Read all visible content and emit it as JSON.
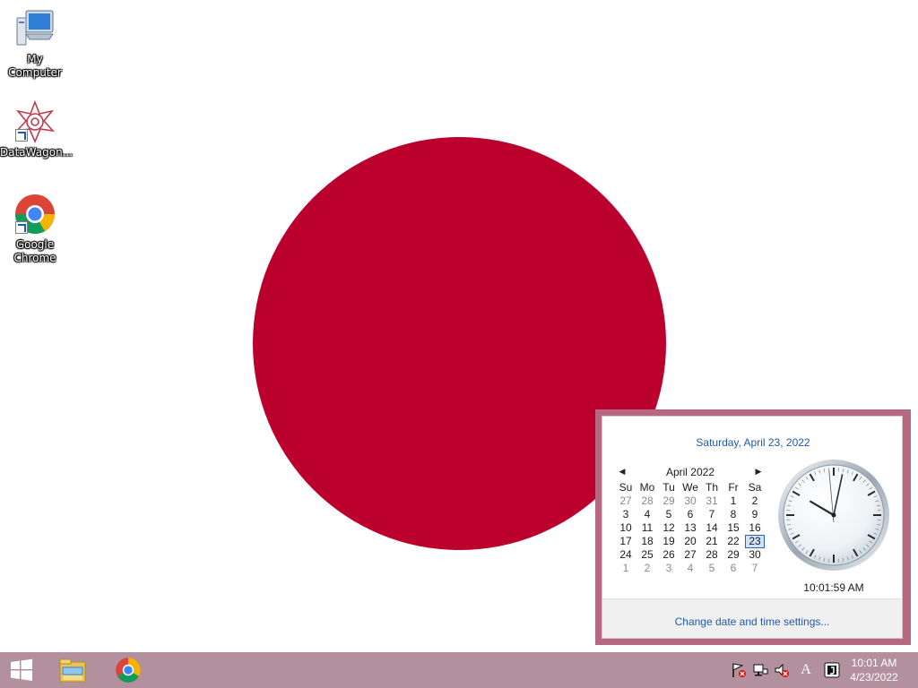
{
  "desktop": {
    "icons": [
      {
        "label": "My Computer"
      },
      {
        "label": "DataWagon..."
      },
      {
        "label": "Google\nChrome"
      }
    ]
  },
  "colors": {
    "wallpaper_background": "#ffffff",
    "wallpaper_sun": "#bc002d",
    "taskbar": "#b3909d",
    "flyout_frame": "#b5687f",
    "link": "#1f5aa6"
  },
  "flyout": {
    "date_header": "Saturday, April 23, 2022",
    "calendar": {
      "month_label": "April 2022",
      "prev_icon": "◀",
      "next_icon": "▶",
      "weekdays": [
        "Su",
        "Mo",
        "Tu",
        "We",
        "Th",
        "Fr",
        "Sa"
      ],
      "weeks": [
        [
          "27",
          "28",
          "29",
          "30",
          "31",
          "1",
          "2"
        ],
        [
          "3",
          "4",
          "5",
          "6",
          "7",
          "8",
          "9"
        ],
        [
          "10",
          "11",
          "12",
          "13",
          "14",
          "15",
          "16"
        ],
        [
          "17",
          "18",
          "19",
          "20",
          "21",
          "22",
          "23"
        ],
        [
          "24",
          "25",
          "26",
          "27",
          "28",
          "29",
          "30"
        ],
        [
          "1",
          "2",
          "3",
          "4",
          "5",
          "6",
          "7"
        ]
      ],
      "other_month_days": {
        "first_row": [
          0,
          1,
          2,
          3,
          4
        ],
        "last_row": [
          0,
          1,
          2,
          3,
          4,
          5,
          6
        ]
      },
      "selected_day": "23"
    },
    "analog_time": {
      "hour": 10,
      "minute": 1,
      "second": 59
    },
    "digital_time": "10:01:59 AM",
    "change_link": "Change date and time settings..."
  },
  "taskbar": {
    "start_icon": "windows-start-icon",
    "pinned": [
      "file-explorer-icon",
      "chrome-icon"
    ],
    "tray_icons": [
      "action-center-flag-icon",
      "network-icon",
      "volume-muted-icon",
      "ime-a-icon",
      "app-tray-icon"
    ],
    "ime_label": "A",
    "clock_time": "10:01 AM",
    "clock_date": "4/23/2022"
  }
}
